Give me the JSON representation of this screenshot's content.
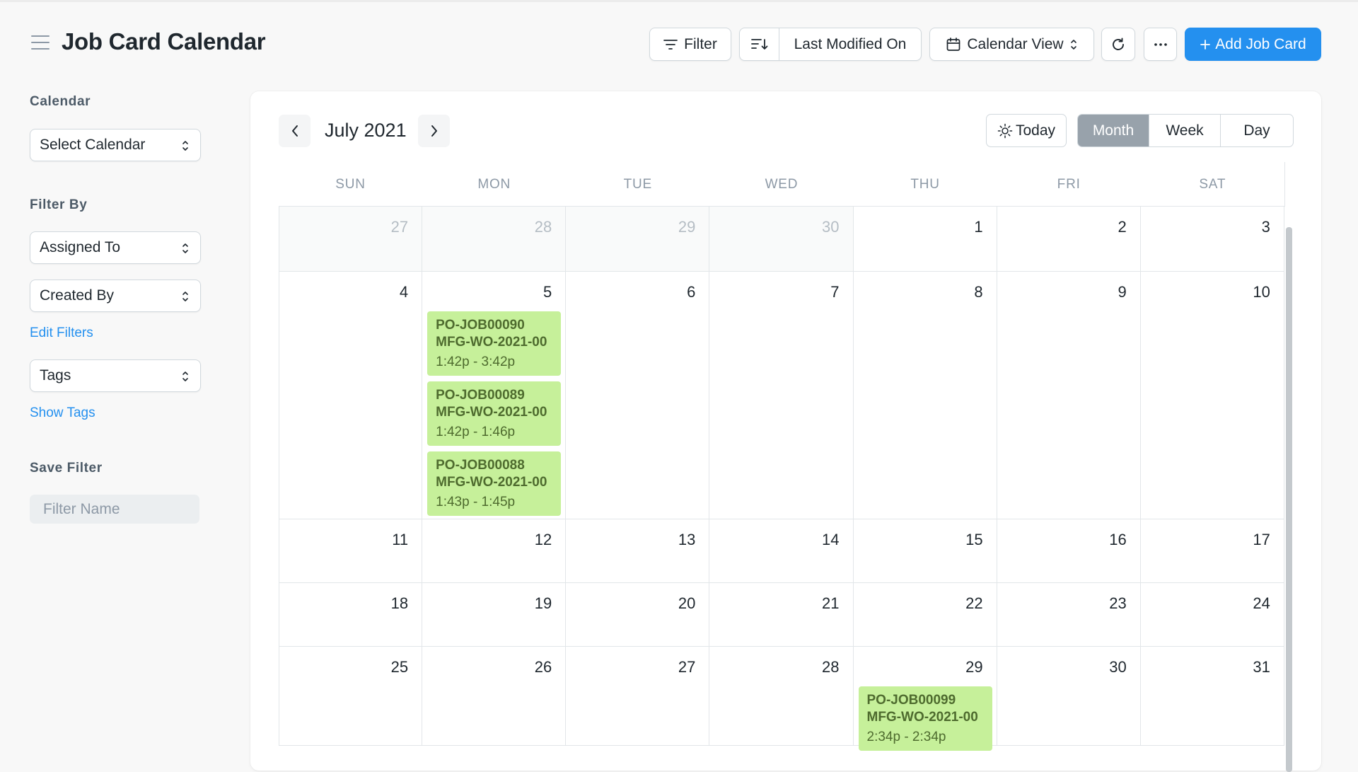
{
  "page": {
    "title": "Job Card Calendar"
  },
  "toolbar": {
    "filter_label": "Filter",
    "sort_label": "Last Modified On",
    "view_label": "Calendar View",
    "add_label": "Add Job Card",
    "accent_color": "#2490ef"
  },
  "sidebar": {
    "calendar_label": "Calendar",
    "calendar_select": "Select Calendar",
    "filter_by_label": "Filter By",
    "assigned_to": "Assigned To",
    "created_by": "Created By",
    "edit_filters": "Edit Filters",
    "tags": "Tags",
    "show_tags": "Show Tags",
    "save_filter_label": "Save Filter",
    "filter_name_placeholder": "Filter Name"
  },
  "calendar": {
    "month_title": "July 2021",
    "today_label": "Today",
    "views": [
      "Month",
      "Week",
      "Day"
    ],
    "active_view": "Month",
    "weekdays": [
      "SUN",
      "MON",
      "TUE",
      "WED",
      "THU",
      "FRI",
      "SAT"
    ],
    "event_color": "#c6f09a",
    "weeks": [
      {
        "days": [
          {
            "num": "27",
            "other": true,
            "events": []
          },
          {
            "num": "28",
            "other": true,
            "events": []
          },
          {
            "num": "29",
            "other": true,
            "events": []
          },
          {
            "num": "30",
            "other": true,
            "events": []
          },
          {
            "num": "1",
            "other": false,
            "events": []
          },
          {
            "num": "2",
            "other": false,
            "events": []
          },
          {
            "num": "3",
            "other": false,
            "events": []
          }
        ]
      },
      {
        "days": [
          {
            "num": "4",
            "other": false,
            "events": []
          },
          {
            "num": "5",
            "other": false,
            "events": [
              {
                "title": "PO-JOB00090",
                "subtitle": "MFG-WO-2021-00",
                "time": "1:42p - 3:42p"
              },
              {
                "title": "PO-JOB00089",
                "subtitle": "MFG-WO-2021-00",
                "time": "1:42p - 1:46p"
              },
              {
                "title": "PO-JOB00088",
                "subtitle": "MFG-WO-2021-00",
                "time": "1:43p - 1:45p"
              }
            ]
          },
          {
            "num": "6",
            "other": false,
            "events": []
          },
          {
            "num": "7",
            "other": false,
            "events": []
          },
          {
            "num": "8",
            "other": false,
            "events": []
          },
          {
            "num": "9",
            "other": false,
            "events": []
          },
          {
            "num": "10",
            "other": false,
            "events": []
          }
        ]
      },
      {
        "days": [
          {
            "num": "11",
            "other": false,
            "events": []
          },
          {
            "num": "12",
            "other": false,
            "events": []
          },
          {
            "num": "13",
            "other": false,
            "events": []
          },
          {
            "num": "14",
            "other": false,
            "events": []
          },
          {
            "num": "15",
            "other": false,
            "events": []
          },
          {
            "num": "16",
            "other": false,
            "events": []
          },
          {
            "num": "17",
            "other": false,
            "events": []
          }
        ]
      },
      {
        "days": [
          {
            "num": "18",
            "other": false,
            "events": []
          },
          {
            "num": "19",
            "other": false,
            "events": []
          },
          {
            "num": "20",
            "other": false,
            "events": []
          },
          {
            "num": "21",
            "other": false,
            "events": []
          },
          {
            "num": "22",
            "other": false,
            "events": []
          },
          {
            "num": "23",
            "other": false,
            "events": []
          },
          {
            "num": "24",
            "other": false,
            "events": []
          }
        ]
      },
      {
        "days": [
          {
            "num": "25",
            "other": false,
            "events": []
          },
          {
            "num": "26",
            "other": false,
            "events": []
          },
          {
            "num": "27",
            "other": false,
            "events": []
          },
          {
            "num": "28",
            "other": false,
            "events": []
          },
          {
            "num": "29",
            "other": false,
            "events": [
              {
                "title": "PO-JOB00099",
                "subtitle": "MFG-WO-2021-00",
                "time": "2:34p - 2:34p"
              }
            ]
          },
          {
            "num": "30",
            "other": false,
            "events": []
          },
          {
            "num": "31",
            "other": false,
            "events": []
          }
        ]
      }
    ]
  }
}
